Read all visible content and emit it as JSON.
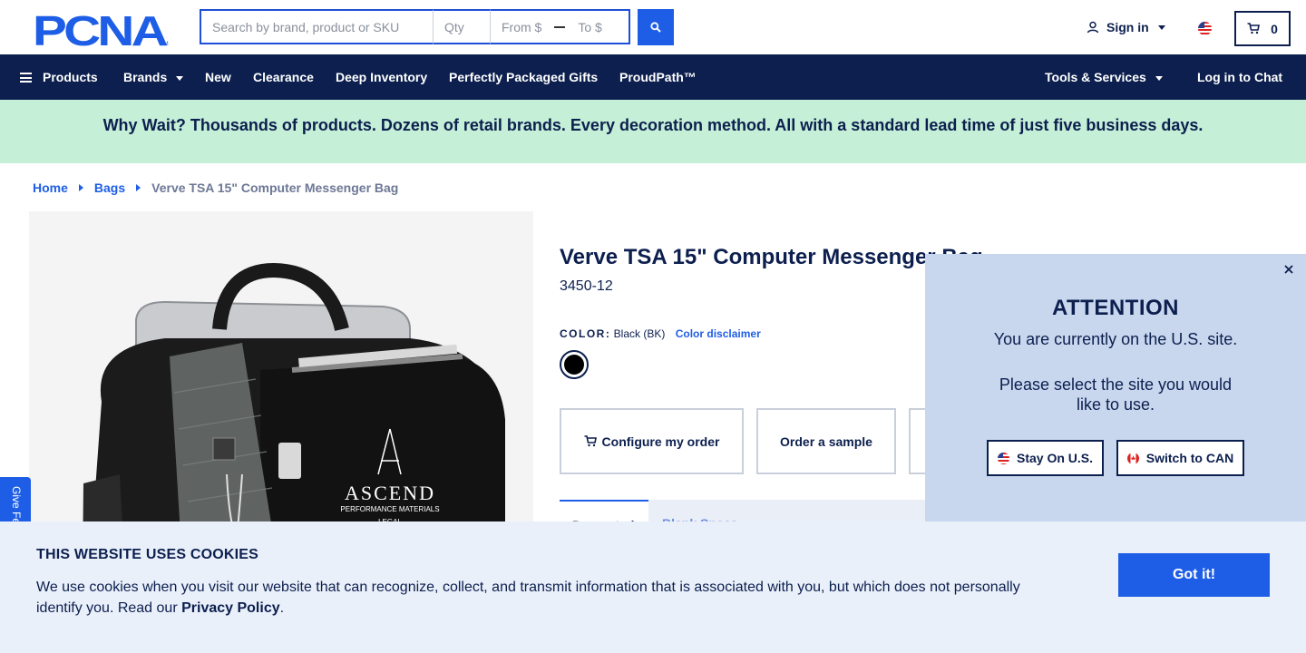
{
  "header": {
    "logo_text": "PCNA",
    "search_placeholder": "Search by brand, product or SKU",
    "qty_placeholder": "Qty",
    "from_label": "From $",
    "to_label": "To $",
    "signin_label": "Sign in",
    "cart_count": "0",
    "icons": [
      "search-icon",
      "user-icon",
      "us-flag-icon",
      "cart-icon"
    ]
  },
  "nav": {
    "products": "Products",
    "brands": "Brands",
    "new": "New",
    "clearance": "Clearance",
    "deep_inventory": "Deep Inventory",
    "gifts": "Perfectly Packaged Gifts",
    "proudpath": "ProudPath™",
    "tools": "Tools & Services",
    "chat": "Log in to Chat"
  },
  "banner": {
    "text": "Why Wait? Thousands of products. Dozens of retail brands. Every decoration method. All with a standard lead time of just five business days."
  },
  "breadcrumb": {
    "home": "Home",
    "bags": "Bags",
    "current": "Verve TSA 15\" Computer Messenger Bag"
  },
  "product": {
    "title": "Verve TSA 15\" Computer Messenger Bag",
    "sku": "3450-12",
    "color_label": "COLOR:",
    "color_value": "Black (BK)",
    "color_disclaimer": "Color disclaimer",
    "swatch_color": "#000000",
    "configure_label": "Configure my order",
    "sample_label": "Order a sample",
    "tab_active": "Decorated",
    "tab_other": "Blank Specs",
    "imprint_brand": "ASCEND",
    "imprint_sub": "PERFORMANCE MATERIALS",
    "imprint_line": "LEGAL"
  },
  "feedback": {
    "label": "Give Feedback"
  },
  "popup": {
    "title": "ATTENTION",
    "message1": "You are currently on the U.S. site.",
    "message2": "Please select the site you would like to use.",
    "stay_label": "Stay On U.S.",
    "switch_label": "Switch to CAN"
  },
  "cookie": {
    "title": "THIS WEBSITE USES COOKIES",
    "text": "We use cookies when you visit our website that can recognize, collect, and transmit information that is associated with you, but which does not personally identify you. Read our ",
    "link": "Privacy Policy",
    "end": ".",
    "button": "Got it!"
  },
  "colors": {
    "navy": "#0c1f4e",
    "blue": "#1e5ee6",
    "banner_green": "#c5efd7",
    "popup_bg": "#c8d7ee",
    "cookie_bg": "#eaf0fa"
  }
}
